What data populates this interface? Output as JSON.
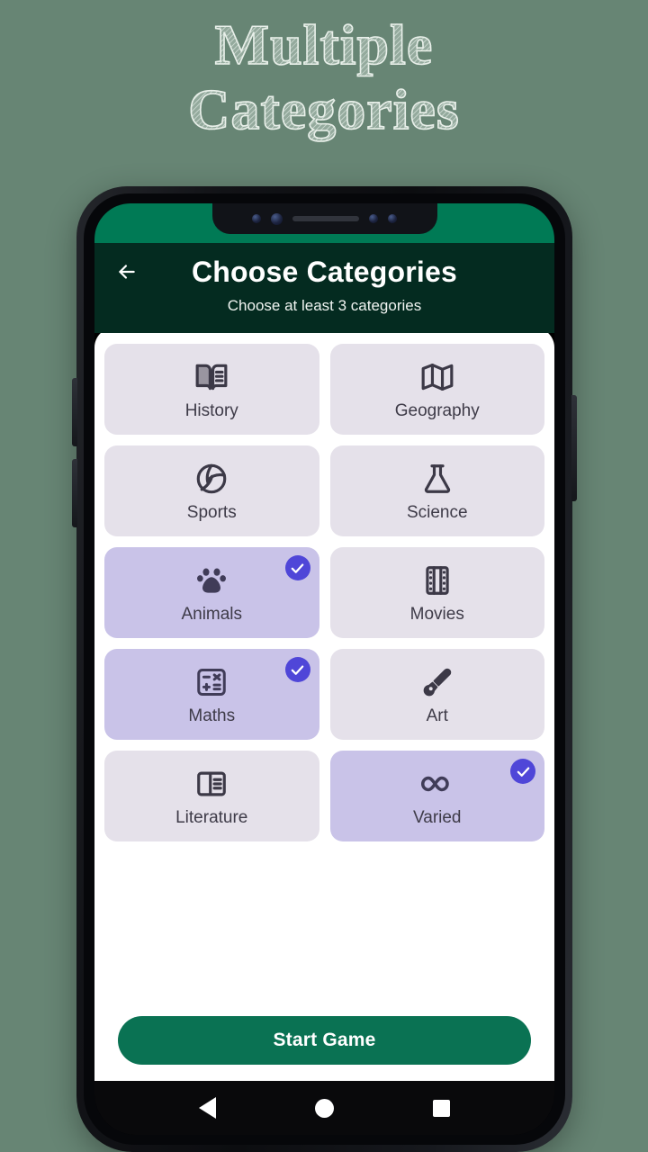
{
  "promo": {
    "line1": "Multiple",
    "line2": "Categories"
  },
  "colors": {
    "page_background": "#678574",
    "status_bar_green": "#007a55",
    "header_green": "#042b20",
    "tile_unselected": "#e5e1ea",
    "tile_selected": "#c9c3e8",
    "check_badge": "#4f46d8",
    "cta_green": "#0a7253",
    "tile_text": "#3e3b48"
  },
  "app": {
    "header": {
      "back_icon": "arrow-left-icon",
      "title": "Choose Categories",
      "subtitle": "Choose at least 3 categories"
    },
    "categories": [
      {
        "label": "History",
        "icon": "open-book-icon",
        "selected": false
      },
      {
        "label": "Geography",
        "icon": "map-icon",
        "selected": false
      },
      {
        "label": "Sports",
        "icon": "volleyball-icon",
        "selected": false
      },
      {
        "label": "Science",
        "icon": "flask-icon",
        "selected": false
      },
      {
        "label": "Animals",
        "icon": "paw-print-icon",
        "selected": true
      },
      {
        "label": "Movies",
        "icon": "film-strip-icon",
        "selected": false
      },
      {
        "label": "Maths",
        "icon": "calculator-icon",
        "selected": true
      },
      {
        "label": "Art",
        "icon": "paintbrush-icon",
        "selected": false
      },
      {
        "label": "Literature",
        "icon": "article-icon",
        "selected": false
      },
      {
        "label": "Varied",
        "icon": "infinity-icon",
        "selected": true
      }
    ],
    "cta": {
      "label": "Start Game"
    },
    "selected_count": 3
  },
  "device": {
    "navigation": {
      "back": "back-triangle-icon",
      "home": "home-circle-icon",
      "recents": "recents-square-icon"
    },
    "side_buttons": [
      "volume-up",
      "volume-down",
      "power"
    ],
    "notch": {
      "sensors": 4,
      "speaker": "earpiece-speaker"
    }
  }
}
